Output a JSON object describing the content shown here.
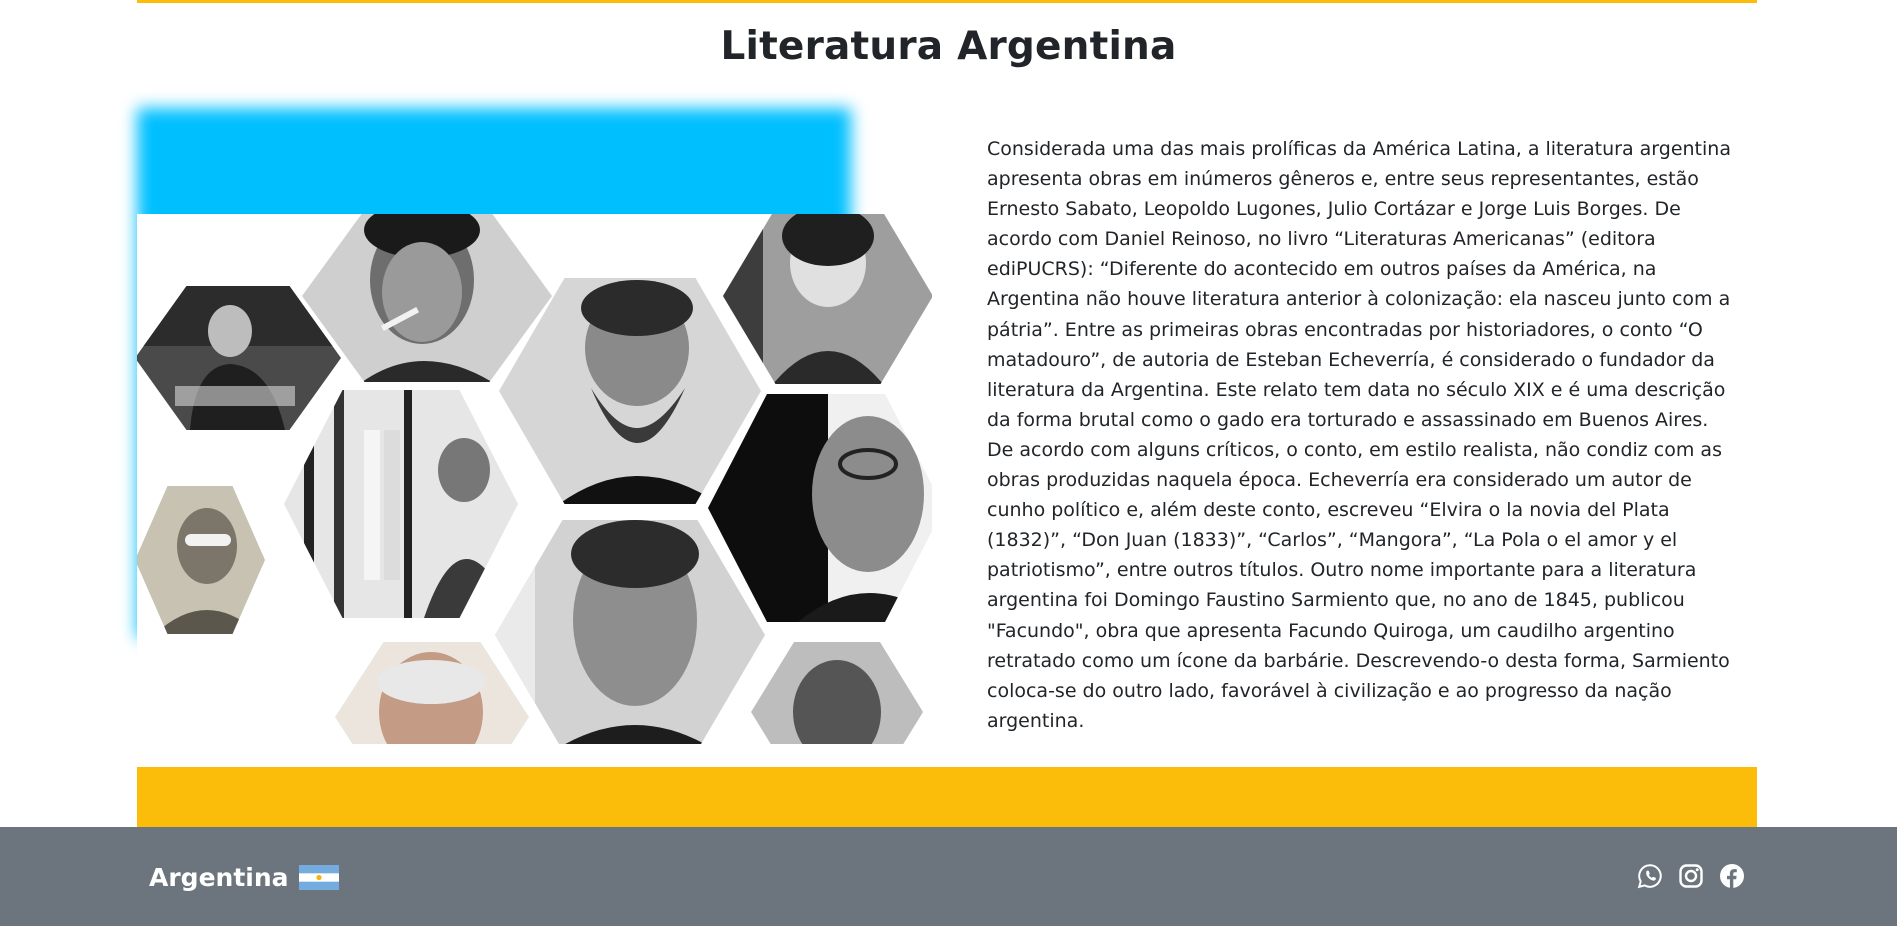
{
  "header": {
    "title": "Literatura Argentina"
  },
  "main": {
    "image_alt": "Collage of Argentine writers",
    "paragraph": "Considerada uma das mais prolíficas da América Latina, a literatura argentina apresenta obras em inúmeros gêneros e, entre seus representantes, estão Ernesto Sabato, Leopoldo Lugones, Julio Cortázar e Jorge Luis Borges. De acordo com Daniel Reinoso, no livro “Literaturas Americanas” (editora ediPUCRS): “Diferente do acontecido em outros países da América, na Argentina não houve literatura anterior à colonização: ela nasceu junto com a pátria”. Entre as primeiras obras encontradas por historiadores, o conto “O matadouro”, de autoria de Esteban Echeverría, é considerado o fundador da literatura da Argentina. Este relato tem data no século XIX e é uma descrição da forma brutal como o gado era torturado e assassinado em Buenos Aires. De acordo com alguns críticos, o conto, em estilo realista, não condiz com as obras produzidas naquela época. Echeverría era considerado um autor de cunho político e, além deste conto, escreveu “Elvira o la novia del Plata (1832)”, “Don Juan (1833)”, “Carlos”, “Mangora”, “La Pola o el amor y el patriotismo”, entre outros títulos. Outro nome importante para a literatura argentina foi Domingo Faustino Sarmiento que, no ano de 1845, publicou \"Facundo\", obra que apresenta Facundo Quiroga, um caudilho argentino retratado como um ícone da barbárie. Descrevendo-o desta forma, Sarmiento coloca-se do outro lado, favorável à civilização e ao progresso da nação argentina."
  },
  "footer": {
    "brand": "Argentina",
    "icons": [
      "whatsapp-icon",
      "instagram-icon",
      "facebook-icon"
    ]
  },
  "colors": {
    "accent_yellow": "#fcbd0a",
    "glow_blue": "#00bfff",
    "footer_gray": "#6c757d",
    "text": "#212529",
    "flag_blue": "#74acdf"
  }
}
